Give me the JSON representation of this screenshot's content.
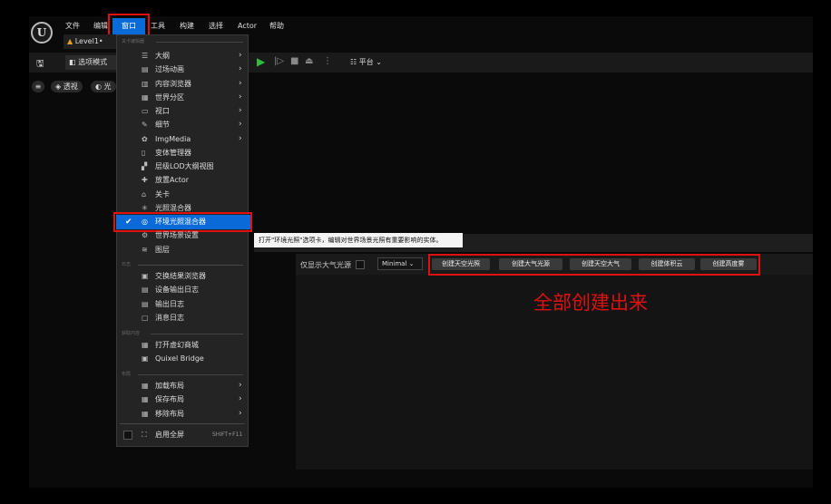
{
  "app": {
    "logo_text": "U",
    "level_tab": "Level1•"
  },
  "menubar": {
    "file": "文件",
    "edit": "编辑",
    "window": "窗口",
    "tools": "工具",
    "build": "构建",
    "select": "选择",
    "actor": "Actor",
    "help": "帮助"
  },
  "toolbar": {
    "mode": "选项模式",
    "platform": "平台"
  },
  "viewport": {
    "perspective": "透视",
    "lighting_short": "光"
  },
  "dropdown": {
    "section1": "关卡编辑器",
    "items1": [
      {
        "label": "大纲",
        "icon": "outline-icon",
        "has_sub": true
      },
      {
        "label": "过场动画",
        "icon": "cinematics-icon",
        "has_sub": true
      },
      {
        "label": "内容浏览器",
        "icon": "content-browser-icon",
        "has_sub": true
      },
      {
        "label": "世界分区",
        "icon": "world-partition-icon",
        "has_sub": true
      },
      {
        "label": "视口",
        "icon": "viewport-icon",
        "has_sub": true
      },
      {
        "label": "细节",
        "icon": "details-icon",
        "has_sub": true
      },
      {
        "label": "ImgMedia",
        "icon": "imgmedia-icon",
        "has_sub": true
      },
      {
        "label": "变体管理器",
        "icon": "variant-manager-icon",
        "has_sub": false
      },
      {
        "label": "层级LOD大纲视图",
        "icon": "hlod-icon",
        "has_sub": false
      },
      {
        "label": "放置Actor",
        "icon": "place-actor-icon",
        "has_sub": false
      },
      {
        "label": "关卡",
        "icon": "levels-icon",
        "has_sub": false
      },
      {
        "label": "光照混合器",
        "icon": "light-mixer-icon",
        "has_sub": false
      },
      {
        "label": "环境光照混合器",
        "icon": "env-light-mixer-icon",
        "has_sub": false
      },
      {
        "label": "世界场景设置",
        "icon": "world-settings-icon",
        "has_sub": false
      },
      {
        "label": "图层",
        "icon": "layers-icon",
        "has_sub": false
      }
    ],
    "section2": "日志",
    "items2": [
      {
        "label": "交换结果浏览器",
        "icon": "results-icon"
      },
      {
        "label": "设备输出日志",
        "icon": "device-log-icon"
      },
      {
        "label": "输出日志",
        "icon": "output-log-icon"
      },
      {
        "label": "消息日志",
        "icon": "message-log-icon"
      }
    ],
    "section3": "获取内容",
    "items3": [
      {
        "label": "打开虚幻商城",
        "icon": "marketplace-icon"
      },
      {
        "label": "Quixel Bridge",
        "icon": "bridge-icon"
      }
    ],
    "section4": "布局",
    "items4": [
      {
        "label": "加载布局",
        "icon": "load-layout-icon"
      },
      {
        "label": "保存布局",
        "icon": "save-layout-icon"
      },
      {
        "label": "移除布局",
        "icon": "remove-layout-icon"
      }
    ],
    "fullscreen": {
      "label": "启用全屏",
      "shortcut": "SHIFT+F11"
    }
  },
  "tooltip": "打开\"环境光照\"选项卡，编辑对世界场景光照有重要影响的实体。",
  "panel": {
    "only_sky_label": "仅显示大气光源",
    "minimal": "Minimal",
    "buttons": [
      "创建天空光照",
      "创建大气光源",
      "创建天空大气",
      "创建体积云",
      "创建高度雾"
    ]
  },
  "annotation": "全部创建出来"
}
